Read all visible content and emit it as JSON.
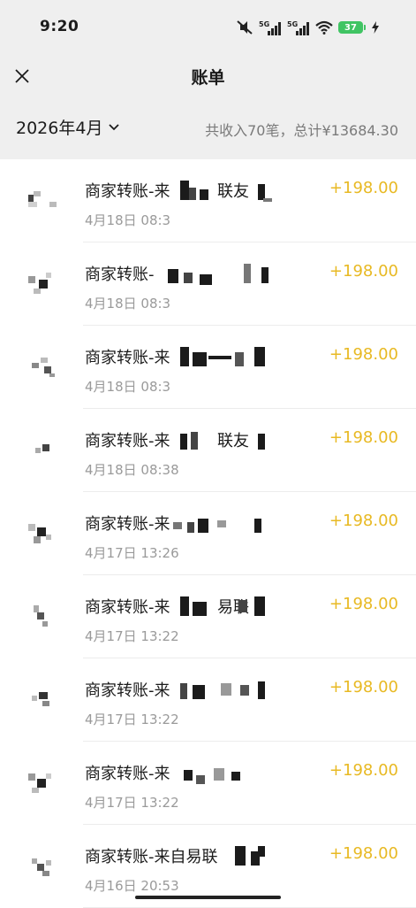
{
  "status_bar": {
    "time": "9:20",
    "signal_label_1": "5G",
    "signal_label_2": "5G",
    "battery": "37",
    "icons": [
      "mute-icon",
      "signal-5g-icon",
      "signal-5g-icon",
      "wifi-icon",
      "battery-icon",
      "charging-icon"
    ]
  },
  "nav": {
    "title": "账单",
    "close_icon": "close-icon"
  },
  "filter": {
    "month": "2026年4月",
    "summary": "共收入70笔，总计¥13684.30",
    "chevron_icon": "chevron-down-icon"
  },
  "transactions": [
    {
      "title": "商家转账-来",
      "title_visible_suffix": "联友",
      "date": "4月18日 08:3",
      "amount": "+198.00"
    },
    {
      "title": "商家转账-",
      "title_visible_suffix": "",
      "date": "4月18日 08:3",
      "amount": "+198.00"
    },
    {
      "title": "商家转账-来",
      "title_visible_suffix": "",
      "date": "4月18日 08:3",
      "amount": "+198.00"
    },
    {
      "title": "商家转账-来",
      "title_visible_suffix": "联友",
      "date": "4月18日 08:38",
      "amount": "+198.00"
    },
    {
      "title": "商家转账-来",
      "title_visible_suffix": "",
      "date": "4月17日 13:26",
      "amount": "+198.00"
    },
    {
      "title": "商家转账-来",
      "title_visible_suffix": "易联",
      "date": "4月17日 13:22",
      "amount": "+198.00"
    },
    {
      "title": "商家转账-来",
      "title_visible_suffix": "",
      "date": "4月17日 13:22",
      "amount": "+198.00"
    },
    {
      "title": "商家转账-来",
      "title_visible_suffix": "",
      "date": "4月17日 13:22",
      "amount": "+198.00"
    },
    {
      "title": "商家转账-来自易联",
      "title_visible_suffix": "",
      "date": "4月16日 20:53",
      "amount": "+198.00"
    }
  ],
  "colors": {
    "amount": "#e8b923",
    "header_bg": "#efefef",
    "battery": "#40c463"
  }
}
